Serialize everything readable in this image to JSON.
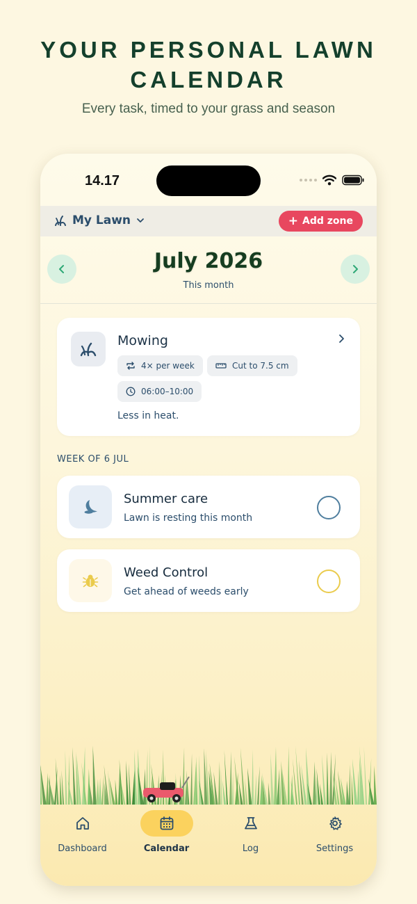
{
  "promo": {
    "title": "YOUR PERSONAL LAWN CALENDAR",
    "subtitle": "Every task, timed to your grass and season"
  },
  "status_bar": {
    "time": "14.17"
  },
  "zone_bar": {
    "lawn_name": "My Lawn",
    "add_zone_label": "Add zone"
  },
  "month_header": {
    "title": "July 2026",
    "subtitle": "This month"
  },
  "mowing_card": {
    "title": "Mowing",
    "frequency": "4× per week",
    "height": "Cut to 7.5 cm",
    "time_window": "06:00–10:00",
    "note": "Less in heat."
  },
  "week": {
    "label": "WEEK OF 6 JUL",
    "tasks": [
      {
        "title": "Summer care",
        "subtitle": "Lawn is resting this month",
        "icon": "moon-icon",
        "color": "#4f7e9e"
      },
      {
        "title": "Weed Control",
        "subtitle": "Get ahead of weeds early",
        "icon": "bug-icon",
        "color": "#eacb4c"
      }
    ]
  },
  "tab_bar": {
    "tabs": [
      {
        "label": "Dashboard",
        "icon": "home-icon"
      },
      {
        "label": "Calendar",
        "icon": "calendar-icon",
        "active": true
      },
      {
        "label": "Log",
        "icon": "flask-icon"
      },
      {
        "label": "Settings",
        "icon": "gear-icon"
      }
    ]
  },
  "colors": {
    "accent_pink": "#e8475f",
    "nav_green": "#d8f1e1",
    "active_tab": "#fbd25e",
    "text_blue": "#2b4d6b",
    "heading_green": "#14402c"
  }
}
